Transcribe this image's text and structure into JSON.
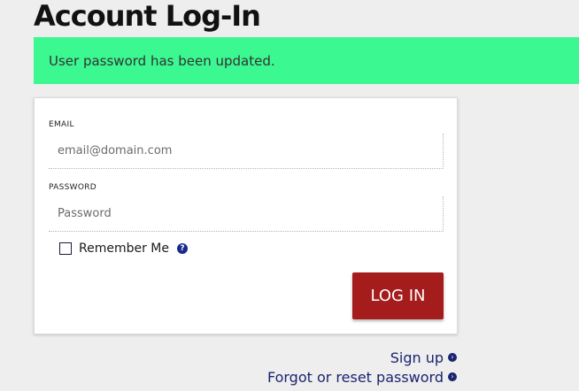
{
  "page": {
    "title": "Account Log-In"
  },
  "alert": {
    "message": "User password has been updated.",
    "color": "#3cf891"
  },
  "form": {
    "email": {
      "label": "EMAIL",
      "placeholder": "email@domain.com",
      "value": ""
    },
    "password": {
      "label": "PASSWORD",
      "placeholder": "Password",
      "value": ""
    },
    "remember": {
      "label": "Remember Me",
      "checked": false,
      "help_icon": "question-circle-icon",
      "help_glyph": "?"
    },
    "submit_label": "LOG IN",
    "submit_color": "#a51c1c"
  },
  "links": [
    {
      "label": "Sign up",
      "icon": "chevron-circle-right-icon"
    },
    {
      "label": "Forgot or reset password",
      "icon": "chevron-circle-right-icon"
    }
  ],
  "link_arrow_glyph": "›"
}
